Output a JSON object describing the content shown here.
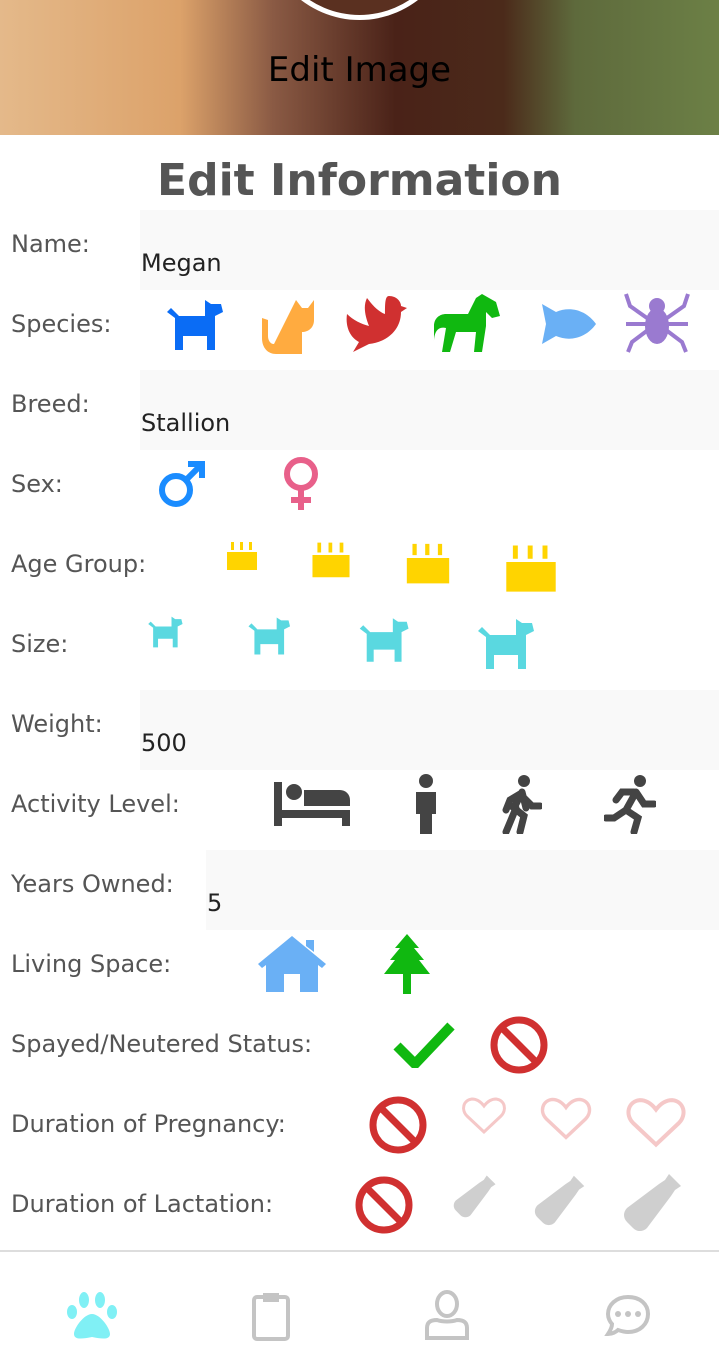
{
  "header": {
    "edit_image_label": "Edit Image"
  },
  "title": "Edit Information",
  "form": {
    "name": {
      "label": "Name:",
      "value": "Megan"
    },
    "species": {
      "label": "Species:",
      "options": [
        "dog",
        "cat",
        "bird",
        "horse",
        "fish",
        "spider"
      ],
      "colors": [
        "#0a6cf5",
        "#ffab40",
        "#d03030",
        "#10b810",
        "#6ab0f5",
        "#9a7ad0"
      ]
    },
    "breed": {
      "label": "Breed:",
      "value": "Stallion"
    },
    "sex": {
      "label": "Sex:",
      "options": [
        "male",
        "female"
      ],
      "colors": [
        "#1a8cff",
        "#e8608a"
      ]
    },
    "age_group": {
      "label": "Age Group:",
      "options": [
        "cake-small",
        "cake-medium",
        "cake-large",
        "cake-xlarge"
      ],
      "color": "#ffd400"
    },
    "size": {
      "label": "Size:",
      "options": [
        "dog-small",
        "dog-medium",
        "dog-large",
        "dog-xlarge"
      ],
      "color": "#5ad8e0"
    },
    "weight": {
      "label": "Weight:",
      "value": "500"
    },
    "activity_level": {
      "label": "Activity Level:",
      "options": [
        "bed",
        "standing",
        "walking",
        "running"
      ],
      "color": "#444"
    },
    "years_owned": {
      "label": "Years Owned:",
      "value": "5"
    },
    "living_space": {
      "label": "Living Space:",
      "options": [
        "house",
        "tree"
      ],
      "colors": [
        "#6ab0f5",
        "#10b810"
      ]
    },
    "spayed": {
      "label": "Spayed/Neutered Status:",
      "options": [
        "check",
        "ban"
      ],
      "colors": [
        "#10b810",
        "#d03030"
      ]
    },
    "pregnancy": {
      "label": "Duration of Pregnancy:",
      "options": [
        "ban",
        "heart-small",
        "heart-medium",
        "heart-large"
      ],
      "colors": [
        "#d03030",
        "#f5c8c8"
      ]
    },
    "lactation": {
      "label": "Duration of Lactation:",
      "options": [
        "ban",
        "bottle-small",
        "bottle-medium",
        "bottle-large"
      ],
      "colors": [
        "#d03030",
        "#cfcfcf"
      ]
    }
  },
  "nav": {
    "items": [
      "pets",
      "clipboard",
      "profile",
      "messages"
    ],
    "active_color": "#80f0f5",
    "inactive_color": "#c4c4c4"
  }
}
